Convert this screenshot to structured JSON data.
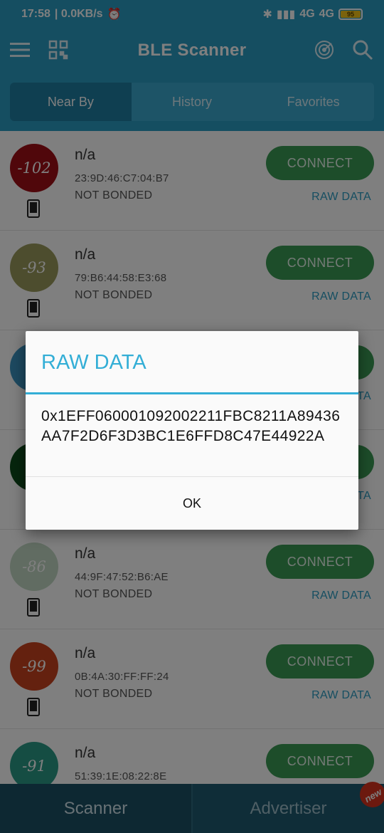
{
  "status_bar": {
    "time": "17:58",
    "speed": "| 0.0KB/s",
    "network1": "4G",
    "network2": "4G",
    "battery": "95"
  },
  "app_bar": {
    "title": "BLE Scanner",
    "menu_icon": "hamburger-menu-icon",
    "qr_icon": "qr-code-icon",
    "radar_icon": "radar-icon",
    "search_icon": "search-icon"
  },
  "tabs": [
    {
      "label": "Near By",
      "active": true
    },
    {
      "label": "History",
      "active": false
    },
    {
      "label": "Favorites",
      "active": false
    }
  ],
  "devices": [
    {
      "rssi": "-102",
      "color": "#a10f16",
      "name": "n/a",
      "address": "23:9D:46:C7:04:B7",
      "bond": "NOT BONDED",
      "connect": "CONNECT",
      "raw": "RAW DATA"
    },
    {
      "rssi": "-93",
      "color": "#9a9a5c",
      "name": "n/a",
      "address": "79:B6:44:58:E3:68",
      "bond": "NOT BONDED",
      "connect": "CONNECT",
      "raw": "RAW DATA"
    },
    {
      "rssi": "",
      "color": "#3a93c0",
      "name": "",
      "address": "",
      "bond": "",
      "connect": "",
      "raw": "TA"
    },
    {
      "rssi": "",
      "color": "#0c4a1a",
      "name": "",
      "address": "",
      "bond": "",
      "connect": "",
      "raw": "TA"
    },
    {
      "rssi": "-86",
      "color": "#c2d8c4",
      "name": "n/a",
      "address": "44:9F:47:52:B6:AE",
      "bond": "NOT BONDED",
      "connect": "CONNECT",
      "raw": "RAW DATA"
    },
    {
      "rssi": "-99",
      "color": "#c8431f",
      "name": "n/a",
      "address": "0B:4A:30:FF:FF:24",
      "bond": "NOT BONDED",
      "connect": "CONNECT",
      "raw": "RAW DATA"
    },
    {
      "rssi": "-91",
      "color": "#2a9a86",
      "name": "n/a",
      "address": "51:39:1E:08:22:8E",
      "bond": "",
      "connect": "CONNECT",
      "raw": ""
    }
  ],
  "dialog": {
    "title": "RAW DATA",
    "body": "0x1EFF060001092002211FBC8211A89436AA7F2D6F3D3BC1E6FFD8C47E44922A",
    "ok": "OK"
  },
  "bottom_nav": {
    "scanner": "Scanner",
    "advertiser": "Advertiser",
    "badge": "new"
  }
}
